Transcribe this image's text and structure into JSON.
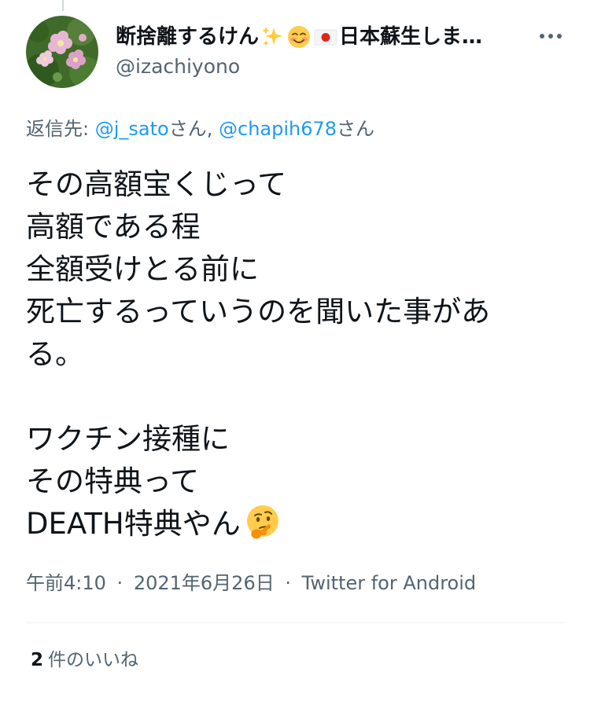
{
  "tweet": {
    "author": {
      "display_name_part1": "断捨離するけん",
      "display_name_part2": "日本蘇生しま…",
      "handle": "@izachiyono",
      "name_emojis": [
        "sparkles-icon",
        "smiling-face-icon",
        "japan-flag-icon"
      ]
    },
    "reply_to": {
      "prefix": "返信先:",
      "mentions": [
        {
          "handle": "@j_sato",
          "suffix": "さん,"
        },
        {
          "handle": "@chapih678",
          "suffix": "さん"
        }
      ]
    },
    "text_lines": [
      "その高額宝くじって",
      "高額である程",
      "全額受けとる前に",
      "死亡するっていうのを聞いた事があ",
      "る。",
      "",
      "ワクチン接種に",
      "その特典って",
      "DEATH特典やん"
    ],
    "trailing_emoji": "thinking-face-icon",
    "time": "午前4:10",
    "separator": "·",
    "date": "2021年6月26日",
    "source": "Twitter for Android",
    "likes": {
      "count": "2",
      "label": "件のいいね"
    }
  },
  "colors": {
    "text": "#0f1419",
    "secondary": "#536471",
    "link": "#1d9bf0",
    "divider": "#eff3f4"
  }
}
